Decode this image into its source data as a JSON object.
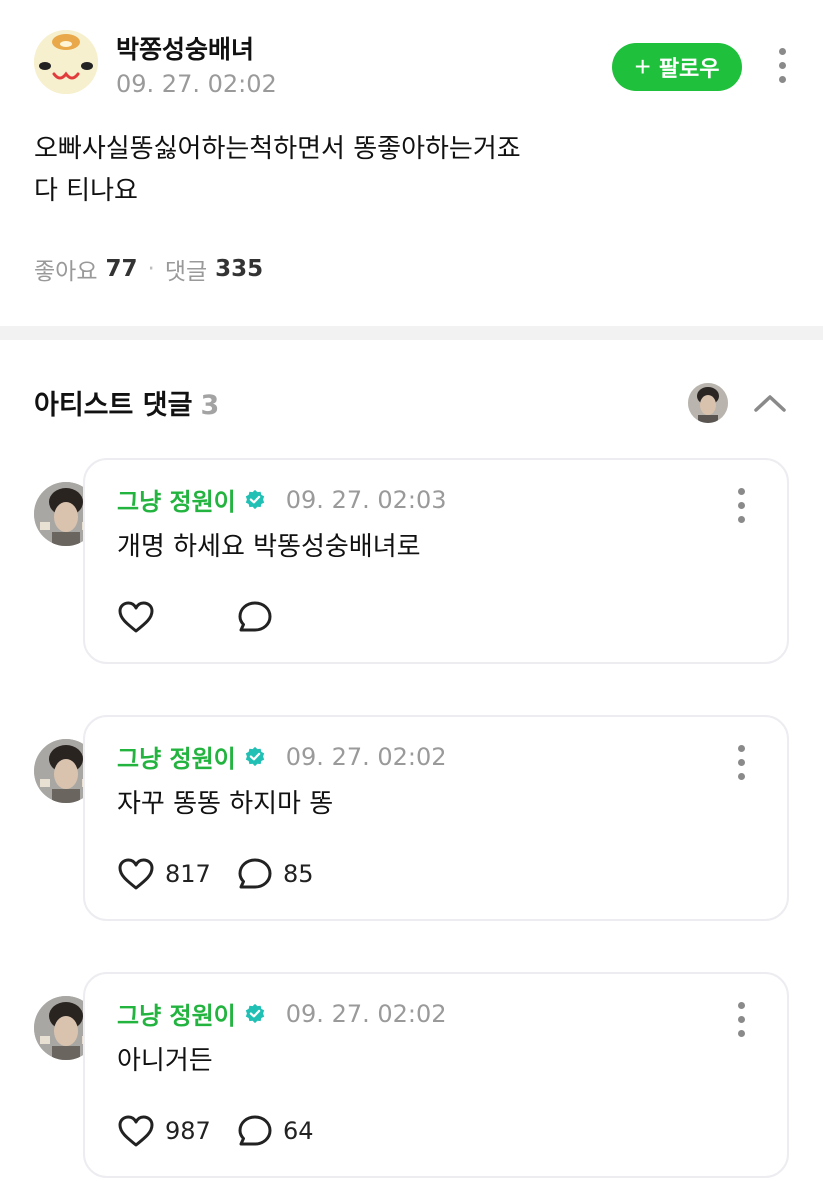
{
  "post": {
    "author": "박쫑성숭배녀",
    "time": "09. 27. 02:02",
    "follow_label": "팔로우",
    "body_lines": [
      "오빠사실똥싫어하는척하면서 똥좋아하는거죠",
      "다 티나요"
    ],
    "stats": {
      "likes_label": "좋아요",
      "likes": "77",
      "comments_label": "댓글",
      "comments": "335"
    }
  },
  "artist_comments": {
    "title": "아티스트 댓글",
    "count": "3",
    "items": [
      {
        "author": "그냥 정원이",
        "time": "09. 27. 02:03",
        "text": "개명 하세요 박똥성숭배녀로",
        "likes": "",
        "replies": ""
      },
      {
        "author": "그냥 정원이",
        "time": "09. 27. 02:02",
        "text": "자꾸 똥똥 하지마 똥",
        "likes": "817",
        "replies": "85"
      },
      {
        "author": "그냥 정원이",
        "time": "09. 27. 02:02",
        "text": "아니거든",
        "likes": "987",
        "replies": "64"
      }
    ]
  },
  "colors": {
    "accent_green": "#1fc03b",
    "name_green": "#23b33f",
    "verified_teal": "#21c0b5"
  },
  "icons": [
    "plus-icon",
    "more-vertical-icon",
    "chevron-up-icon",
    "verified-badge-icon",
    "heart-icon",
    "comment-bubble-icon"
  ]
}
